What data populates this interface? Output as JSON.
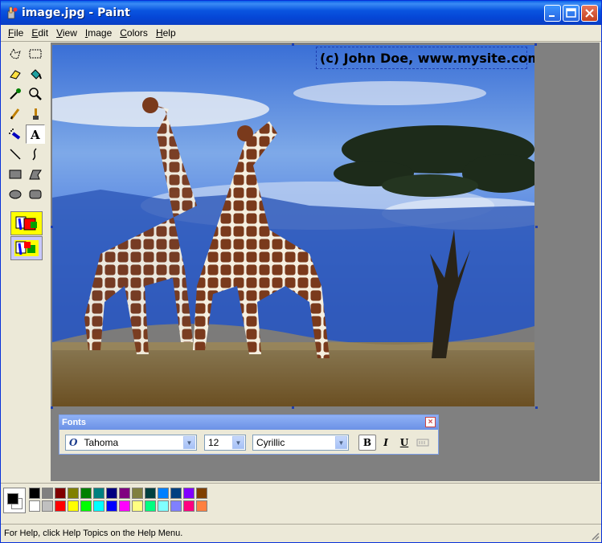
{
  "window": {
    "title": "image.jpg - Paint"
  },
  "menu": [
    {
      "key": "F",
      "rest": "ile"
    },
    {
      "key": "E",
      "rest": "dit"
    },
    {
      "key": "V",
      "rest": "iew"
    },
    {
      "key": "I",
      "rest": "mage"
    },
    {
      "key": "C",
      "rest": "olors"
    },
    {
      "key": "H",
      "rest": "elp"
    }
  ],
  "tools": [
    "free-select",
    "rect-select",
    "eraser",
    "fill",
    "color-picker",
    "magnifier",
    "pencil",
    "brush",
    "airbrush",
    "text",
    "line",
    "curve",
    "rectangle",
    "polygon",
    "ellipse",
    "rounded-rect"
  ],
  "canvas": {
    "text_overlay": "(c) John Doe, www.mysite.com"
  },
  "fonts_toolbar": {
    "title": "Fonts",
    "font": "Tahoma",
    "size": "12",
    "script": "Cyrillic",
    "bold": "B",
    "italic": "I",
    "underline": "U"
  },
  "palette": {
    "primary": "#000000",
    "secondary": "#ffffff",
    "row1": [
      "#000000",
      "#808080",
      "#800000",
      "#808000",
      "#008000",
      "#008080",
      "#000080",
      "#800080",
      "#808040",
      "#004040",
      "#0080ff",
      "#004080",
      "#8000ff",
      "#804000"
    ],
    "row2": [
      "#ffffff",
      "#c0c0c0",
      "#ff0000",
      "#ffff00",
      "#00ff00",
      "#00ffff",
      "#0000ff",
      "#ff00ff",
      "#ffff80",
      "#00ff80",
      "#80ffff",
      "#8080ff",
      "#ff0080",
      "#ff8040"
    ]
  },
  "status": {
    "text": "For Help, click Help Topics on the Help Menu."
  }
}
